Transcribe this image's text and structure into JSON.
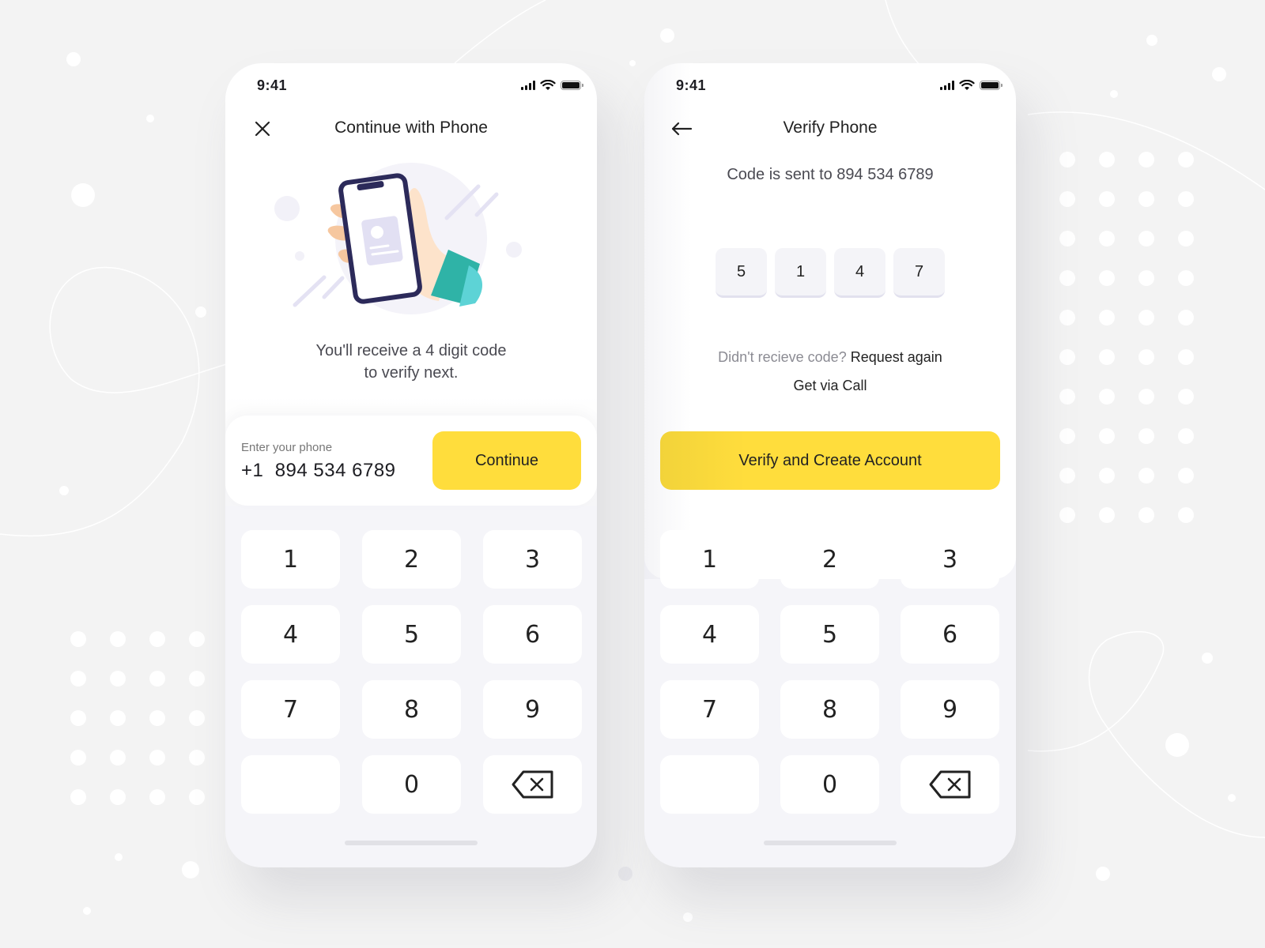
{
  "colors": {
    "accent": "#ffdd3c",
    "background": "#f3f3f3",
    "card": "#ffffff",
    "keypad_bg": "#f5f5f9",
    "otp_box": "#f4f4f8",
    "illustration_phone": "#2c2a5a",
    "illustration_sleeve": "#2fb3a7",
    "illustration_skin": "#fad8b8"
  },
  "screens": [
    {
      "id": "continue-with-phone",
      "status_bar": {
        "time": "9:41",
        "icons": [
          "signal-icon",
          "wifi-icon",
          "battery-icon"
        ]
      },
      "nav": {
        "leading_icon": "close-icon",
        "title": "Continue with Phone"
      },
      "illustration": "hand-holding-phone-illustration",
      "subtitle_line1": "You'll receive a 4 digit code",
      "subtitle_line2": "to verify next.",
      "phone_input": {
        "label": "Enter your phone",
        "value": "+1  894 534 6789"
      },
      "continue_button": "Continue",
      "keypad": {
        "keys": [
          "1",
          "2",
          "3",
          "4",
          "5",
          "6",
          "7",
          "8",
          "9",
          "",
          "0",
          "backspace"
        ]
      }
    },
    {
      "id": "verify-phone",
      "status_bar": {
        "time": "9:41",
        "icons": [
          "signal-icon",
          "wifi-icon",
          "battery-icon"
        ]
      },
      "nav": {
        "leading_icon": "back-arrow-icon",
        "title": "Verify Phone"
      },
      "code_sent_text": "Code is sent to 894 534 6789",
      "otp_digits": [
        "5",
        "1",
        "4",
        "7"
      ],
      "resend_prompt": "Didn't recieve code?",
      "resend_link": "Request again",
      "call_link": "Get via Call",
      "verify_button": "Verify and Create Account",
      "keypad": {
        "keys": [
          "1",
          "2",
          "3",
          "4",
          "5",
          "6",
          "7",
          "8",
          "9",
          "",
          "0",
          "backspace"
        ]
      }
    }
  ]
}
